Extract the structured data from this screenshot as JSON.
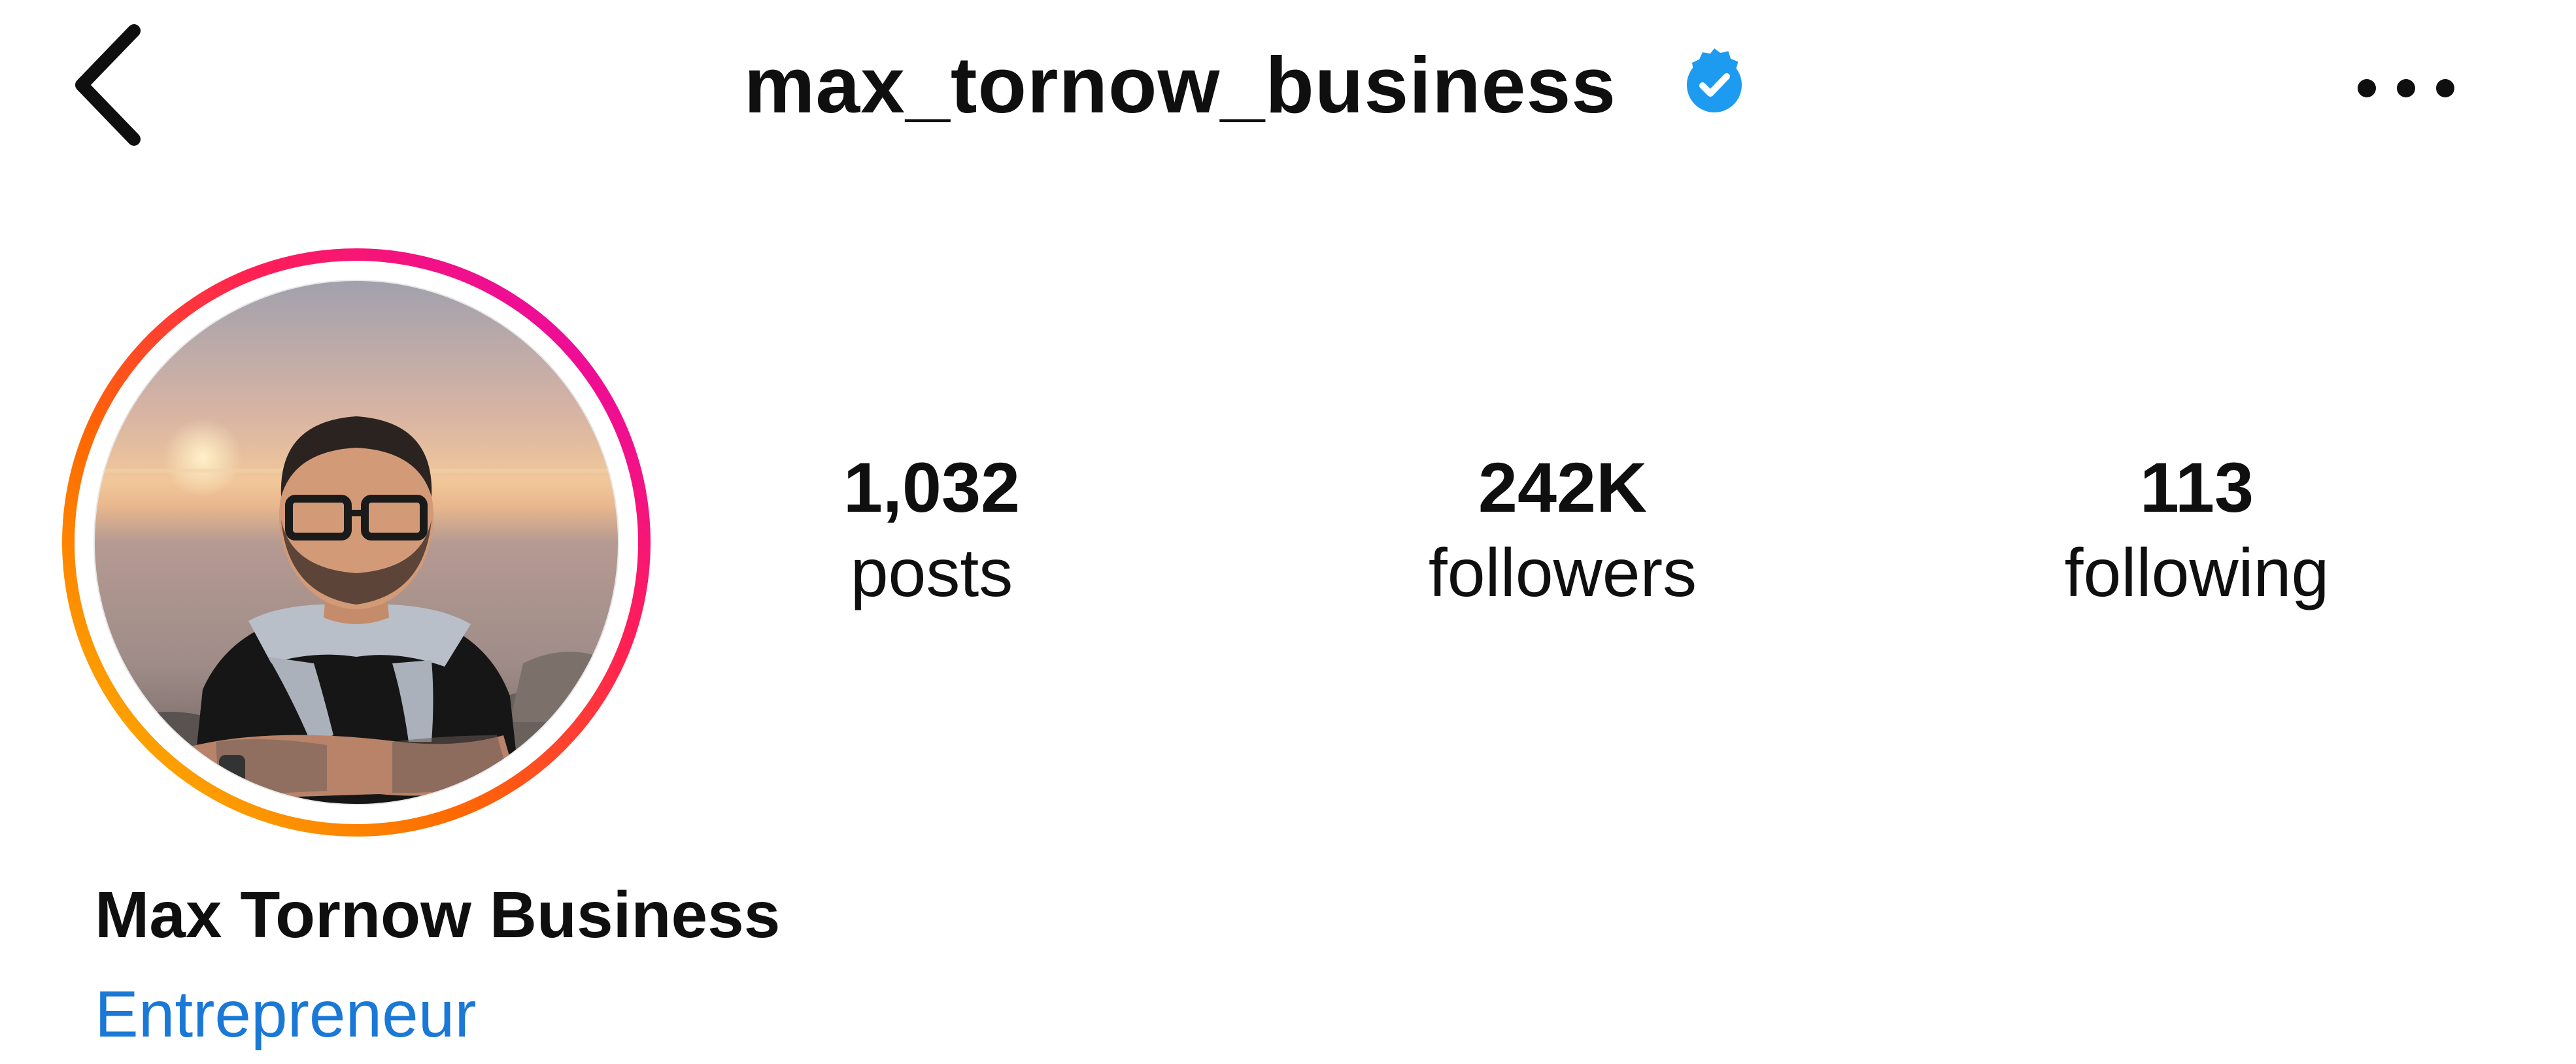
{
  "header": {
    "username": "max_tornow_business",
    "back_icon": "chevron-left-icon",
    "verified_icon": "verified-badge-icon",
    "more_icon": "more-horizontal-icon"
  },
  "profile": {
    "display_name": "Max Tornow Business",
    "category": "Entrepreneur"
  },
  "stats": {
    "posts": {
      "value": "1,032",
      "label": "posts"
    },
    "followers": {
      "value": "242K",
      "label": "followers"
    },
    "following": {
      "value": "113",
      "label": "following"
    }
  },
  "colors": {
    "text": "#0f0f0f",
    "verified_blue": "#1d9bf0",
    "category_blue": "#1a78d6",
    "story_ring": [
      "#f9c800",
      "#ff6a00",
      "#ff1e56",
      "#e100c6"
    ]
  }
}
